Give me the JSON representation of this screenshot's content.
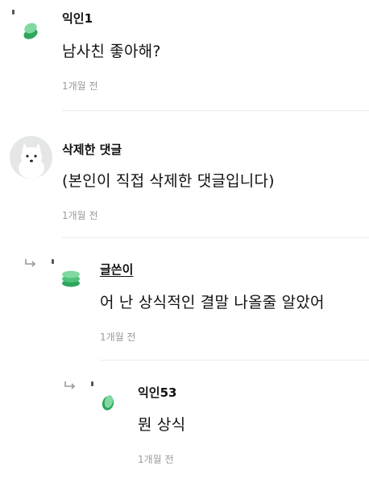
{
  "comments": [
    {
      "author": "익인1",
      "text": "남사친 좋아해?",
      "time": "1개월 전",
      "icon": "green-stack-icon"
    },
    {
      "author": "삭제한 댓글",
      "text": "(본인이 직접 삭제한 댓글입니다)",
      "time": "1개월 전",
      "icon": "dog-avatar"
    },
    {
      "author": "글쓴이",
      "text": "어 난 상식적인 결말 나올줄 알았어",
      "time": "1개월 전",
      "icon": "green-stack-icon",
      "is_reply": true
    },
    {
      "author": "익인53",
      "text": "뭔 상식",
      "time": "1개월 전",
      "icon": "green-stack-icon",
      "is_reply": true
    }
  ],
  "colors": {
    "accent_green": "#3dbb6e",
    "accent_green_light": "#7fd9a0",
    "meta_gray": "#9a9a9a"
  }
}
